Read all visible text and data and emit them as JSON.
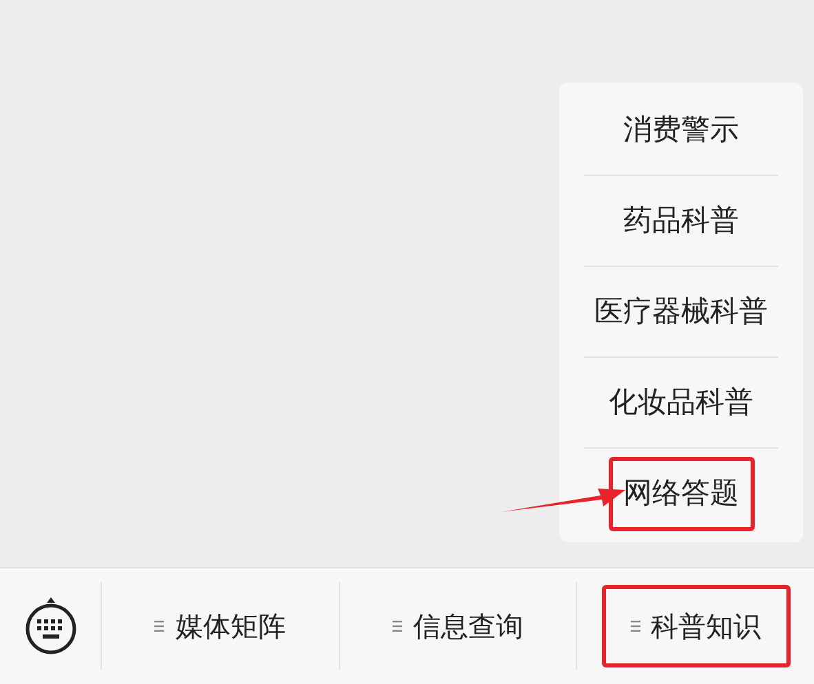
{
  "submenu": {
    "items": [
      {
        "label": "消费警示",
        "highlighted": false
      },
      {
        "label": "药品科普",
        "highlighted": false
      },
      {
        "label": "医疗器械科普",
        "highlighted": false
      },
      {
        "label": "化妆品科普",
        "highlighted": false
      },
      {
        "label": "网络答题",
        "highlighted": true
      }
    ]
  },
  "menu_bar": {
    "items": [
      {
        "label": "媒体矩阵",
        "highlighted": false
      },
      {
        "label": "信息查询",
        "highlighted": false
      },
      {
        "label": "科普知识",
        "highlighted": true
      }
    ]
  }
}
